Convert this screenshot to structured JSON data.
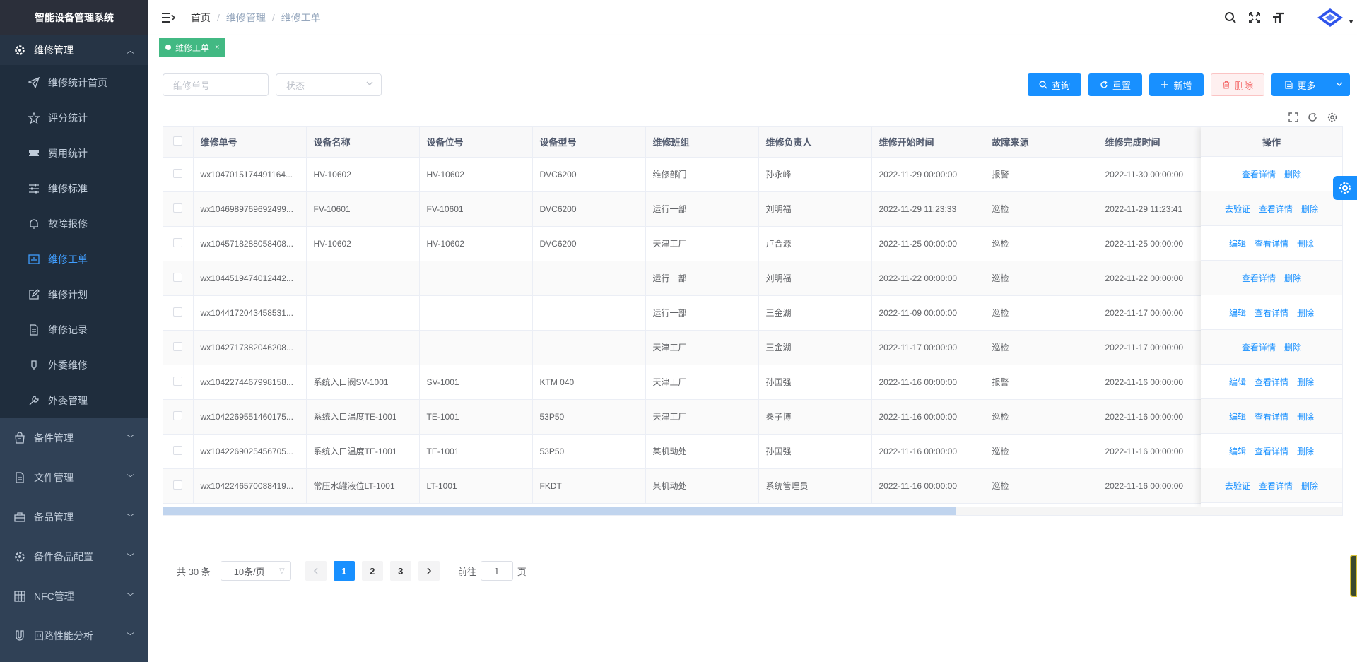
{
  "app": {
    "title": "智能设备管理系统"
  },
  "sidebar": {
    "open_group": "维修管理",
    "items": [
      {
        "label": "维修统计首页",
        "icon": "paper-plane-icon"
      },
      {
        "label": "评分统计",
        "icon": "star-icon"
      },
      {
        "label": "费用统计",
        "icon": "ticket-icon"
      },
      {
        "label": "维修标准",
        "icon": "sliders-icon"
      },
      {
        "label": "故障报修",
        "icon": "bell-icon"
      },
      {
        "label": "维修工单",
        "icon": "chart-icon",
        "active": true
      },
      {
        "label": "维修计划",
        "icon": "edit-icon"
      },
      {
        "label": "维修记录",
        "icon": "document-icon"
      },
      {
        "label": "外委维修",
        "icon": "bulb-icon"
      },
      {
        "label": "外委管理",
        "icon": "tool-icon"
      }
    ],
    "groups": [
      {
        "label": "备件管理",
        "icon": "bag-icon"
      },
      {
        "label": "文件管理",
        "icon": "file-icon"
      },
      {
        "label": "备品管理",
        "icon": "briefcase-icon"
      },
      {
        "label": "备件备品配置",
        "icon": "gear-icon"
      },
      {
        "label": "NFC管理",
        "icon": "grid-icon"
      },
      {
        "label": "回路性能分析",
        "icon": "magnet-icon"
      }
    ]
  },
  "breadcrumb": [
    "首页",
    "维修管理",
    "维修工单"
  ],
  "tags": [
    {
      "label": "维修工单",
      "active": true
    }
  ],
  "filters": {
    "order_no_placeholder": "维修单号",
    "status_placeholder": "状态"
  },
  "toolbar": {
    "query": "查询",
    "reset": "重置",
    "add": "新增",
    "delete": "删除",
    "more": "更多"
  },
  "table": {
    "columns": [
      "维修单号",
      "设备名称",
      "设备位号",
      "设备型号",
      "维修班组",
      "维修负责人",
      "维修开始时间",
      "故障来源",
      "维修完成时间"
    ],
    "action_header": "操作",
    "rows": [
      {
        "cells": [
          "wx1047015174491164...",
          "HV-10602",
          "HV-10602",
          "DVC6200",
          "维修部门",
          "孙永峰",
          "2022-11-29 00:00:00",
          "报警",
          "2022-11-30 00:00:00"
        ],
        "actions": [
          "查看详情",
          "删除"
        ]
      },
      {
        "cells": [
          "wx1046989769692499...",
          "FV-10601",
          "FV-10601",
          "DVC6200",
          "运行一部",
          "刘明福",
          "2022-11-29 11:23:33",
          "巡检",
          "2022-11-29 11:23:41"
        ],
        "actions": [
          "去验证",
          "查看详情",
          "删除"
        ]
      },
      {
        "cells": [
          "wx1045718288058408...",
          "HV-10602",
          "HV-10602",
          "DVC6200",
          "天津工厂",
          "卢合源",
          "2022-11-25 00:00:00",
          "巡检",
          "2022-11-25 00:00:00"
        ],
        "actions": [
          "编辑",
          "查看详情",
          "删除"
        ]
      },
      {
        "cells": [
          "wx1044519474012442...",
          "",
          "",
          "",
          "运行一部",
          "刘明福",
          "2022-11-22 00:00:00",
          "巡检",
          "2022-11-22 00:00:00"
        ],
        "actions": [
          "查看详情",
          "删除"
        ]
      },
      {
        "cells": [
          "wx1044172043458531...",
          "",
          "",
          "",
          "运行一部",
          "王金湖",
          "2022-11-09 00:00:00",
          "巡检",
          "2022-11-17 00:00:00"
        ],
        "actions": [
          "编辑",
          "查看详情",
          "删除"
        ]
      },
      {
        "cells": [
          "wx1042717382046208...",
          "",
          "",
          "",
          "天津工厂",
          "王金湖",
          "2022-11-17 00:00:00",
          "巡检",
          "2022-11-17 00:00:00"
        ],
        "actions": [
          "查看详情",
          "删除"
        ]
      },
      {
        "cells": [
          "wx1042274467998158...",
          "系统入口阀SV-1001",
          "SV-1001",
          "KTM 040",
          "天津工厂",
          "孙国强",
          "2022-11-16 00:00:00",
          "报警",
          "2022-11-16 00:00:00"
        ],
        "actions": [
          "编辑",
          "查看详情",
          "删除"
        ]
      },
      {
        "cells": [
          "wx1042269551460175...",
          "系统入口温度TE-1001",
          "TE-1001",
          "53P50",
          "天津工厂",
          "桑子博",
          "2022-11-16 00:00:00",
          "巡检",
          "2022-11-16 00:00:00"
        ],
        "actions": [
          "编辑",
          "查看详情",
          "删除"
        ]
      },
      {
        "cells": [
          "wx1042269025456705...",
          "系统入口温度TE-1001",
          "TE-1001",
          "53P50",
          "某机动处",
          "孙国强",
          "2022-11-16 00:00:00",
          "巡检",
          "2022-11-16 00:00:00"
        ],
        "actions": [
          "编辑",
          "查看详情",
          "删除"
        ]
      },
      {
        "cells": [
          "wx1042246570088419...",
          "常压水罐液位LT-1001",
          "LT-1001",
          "FKDT",
          "某机动处",
          "系统管理员",
          "2022-11-16 00:00:00",
          "巡检",
          "2022-11-16 00:00:00"
        ],
        "actions": [
          "去验证",
          "查看详情",
          "删除"
        ]
      }
    ]
  },
  "pagination": {
    "total_label": "共 30 条",
    "page_size": "10条/页",
    "pages": [
      "1",
      "2",
      "3"
    ],
    "current": "1",
    "goto_label": "前往",
    "goto_value": "1",
    "page_suffix": "页"
  },
  "colors": {
    "sidebar_bg": "#304156",
    "accent": "#1890ff",
    "tag_green": "#42b983",
    "danger": "#f56c6c"
  }
}
